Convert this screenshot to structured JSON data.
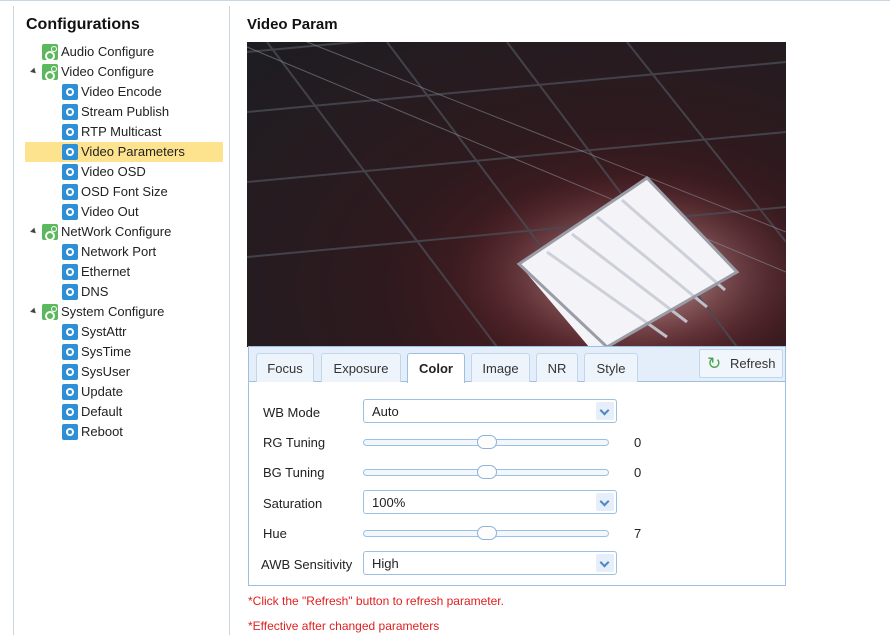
{
  "sidebar": {
    "title": "Configurations",
    "tree": [
      {
        "label": "Audio Configure",
        "icon": "gear-group-icon"
      },
      {
        "label": "Video Configure",
        "icon": "gear-group-icon",
        "expanded": true
      },
      {
        "label": "Video Encode",
        "icon": "settings-item-icon"
      },
      {
        "label": "Stream Publish",
        "icon": "settings-item-icon"
      },
      {
        "label": "RTP Multicast",
        "icon": "settings-item-icon"
      },
      {
        "label": "Video Parameters",
        "icon": "settings-item-icon",
        "selected": true
      },
      {
        "label": "Video OSD",
        "icon": "settings-item-icon"
      },
      {
        "label": "OSD Font Size",
        "icon": "settings-item-icon"
      },
      {
        "label": "Video Out",
        "icon": "settings-item-icon"
      },
      {
        "label": "NetWork Configure",
        "icon": "gear-group-icon",
        "expanded": true
      },
      {
        "label": "Network Port",
        "icon": "settings-item-icon"
      },
      {
        "label": "Ethernet",
        "icon": "settings-item-icon"
      },
      {
        "label": "DNS",
        "icon": "settings-item-icon"
      },
      {
        "label": "System Configure",
        "icon": "gear-group-icon",
        "expanded": true
      },
      {
        "label": "SystAttr",
        "icon": "settings-item-icon"
      },
      {
        "label": "SysTime",
        "icon": "settings-item-icon"
      },
      {
        "label": "SysUser",
        "icon": "settings-item-icon"
      },
      {
        "label": "Update",
        "icon": "settings-item-icon"
      },
      {
        "label": "Default",
        "icon": "settings-item-icon"
      },
      {
        "label": "Reboot",
        "icon": "settings-item-icon"
      }
    ]
  },
  "main": {
    "title": "Video Param",
    "tabs": [
      {
        "label": "Focus"
      },
      {
        "label": "Exposure"
      },
      {
        "label": "Color",
        "active": true
      },
      {
        "label": "Image"
      },
      {
        "label": "NR"
      },
      {
        "label": "Style"
      }
    ],
    "refresh_label": "Refresh",
    "color": {
      "wb_mode": {
        "label": "WB Mode",
        "value": "Auto"
      },
      "rg_tuning": {
        "label": "RG Tuning",
        "value": "0",
        "level": 0.5
      },
      "bg_tuning": {
        "label": "BG Tuning",
        "value": "0",
        "level": 0.5
      },
      "saturation": {
        "label": "Saturation",
        "value": "100%"
      },
      "hue": {
        "label": "Hue",
        "value": "7",
        "level": 0.5
      },
      "awb_sensitivity": {
        "label": "AWB Sensitivity",
        "value": "High"
      }
    },
    "notes": [
      "*Click the \"Refresh\" button to refresh parameter.",
      "*Effective after changed parameters"
    ]
  },
  "colors": {
    "accent": "#2f8fd6",
    "selected_bg": "#fde38d",
    "border": "#9cc0e2",
    "note": "#e02020",
    "group_icon": "#5cb85c"
  }
}
